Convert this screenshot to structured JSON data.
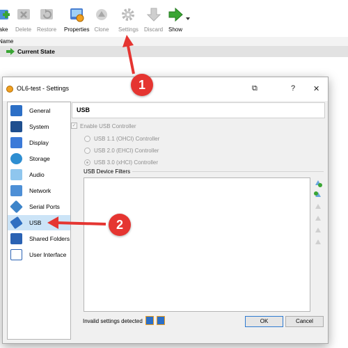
{
  "toolbar": {
    "buttons": [
      {
        "label": "ake",
        "enabled": true
      },
      {
        "label": "Delete",
        "enabled": false
      },
      {
        "label": "Restore",
        "enabled": false
      },
      {
        "label": "Properties",
        "enabled": true
      },
      {
        "label": "Clone",
        "enabled": false
      },
      {
        "label": "Settings",
        "enabled": false
      },
      {
        "label": "Discard",
        "enabled": false
      },
      {
        "label": "Show",
        "enabled": true
      }
    ]
  },
  "snapshots": {
    "column_header": "Name",
    "current_state": "Current State"
  },
  "dialog": {
    "title": "OL6-test - Settings",
    "controls": {
      "pin": "⧉",
      "help": "?",
      "close": "✕"
    },
    "sidebar": [
      {
        "label": "General",
        "icon": "general-icon",
        "selected": false
      },
      {
        "label": "System",
        "icon": "system-icon",
        "selected": false
      },
      {
        "label": "Display",
        "icon": "display-icon",
        "selected": false
      },
      {
        "label": "Storage",
        "icon": "storage-icon",
        "selected": false
      },
      {
        "label": "Audio",
        "icon": "audio-icon",
        "selected": false
      },
      {
        "label": "Network",
        "icon": "network-icon",
        "selected": false
      },
      {
        "label": "Serial Ports",
        "icon": "serial-ports-icon",
        "selected": false
      },
      {
        "label": "USB",
        "icon": "usb-icon",
        "selected": true
      },
      {
        "label": "Shared Folders",
        "icon": "shared-folders-icon",
        "selected": false
      },
      {
        "label": "User Interface",
        "icon": "user-interface-icon",
        "selected": false
      }
    ],
    "page_title": "USB",
    "enable_usb": {
      "label": "Enable USB Controller",
      "checked": true
    },
    "controllers": [
      {
        "label": "USB 1.1 (OHCI) Controller",
        "selected": false
      },
      {
        "label": "USB 2.0 (EHCI) Controller",
        "selected": false
      },
      {
        "label": "USB 3.0 (xHCI) Controller",
        "selected": true
      }
    ],
    "filters_label": "USB Device Filters",
    "filter_buttons": [
      "add-filter-icon",
      "add-from-device-icon",
      "edit-filter-icon",
      "remove-filter-icon",
      "move-up-icon",
      "move-down-icon"
    ],
    "status": "Invalid settings detected",
    "ok": "OK",
    "cancel": "Cancel"
  },
  "callouts": [
    "1",
    "2"
  ],
  "colors": {
    "accent_red": "#e53531",
    "selection": "#cce4f7",
    "show_green": "#3aa534"
  }
}
